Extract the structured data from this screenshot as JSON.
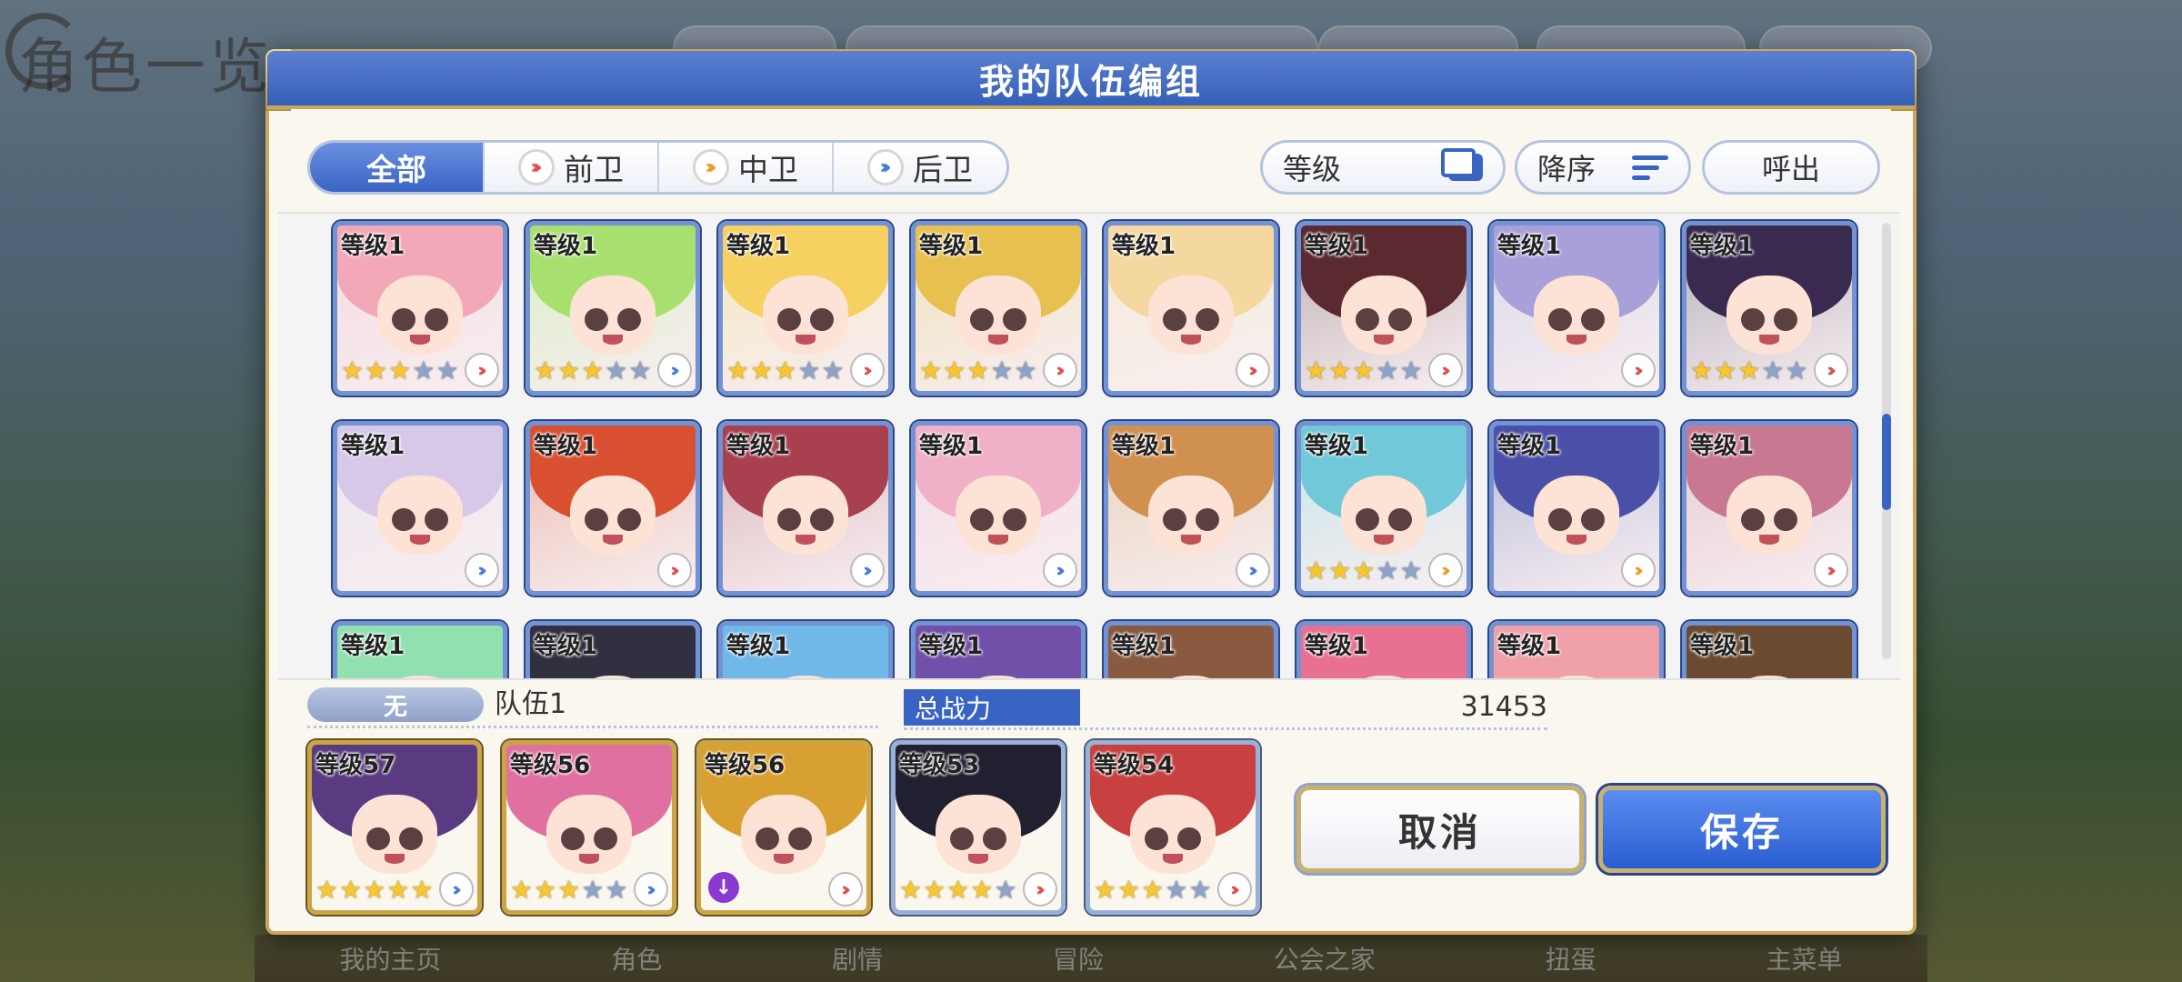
{
  "background": {
    "title": "角色一览",
    "nav": [
      "我的主页",
      "角色",
      "剧情",
      "冒险",
      "公会之家",
      "扭蛋",
      "主菜单"
    ]
  },
  "modal": {
    "title": "我的队伍编组",
    "tabs": [
      {
        "label": "全部",
        "icon": ""
      },
      {
        "label": "前卫",
        "icon": "front-role-icon"
      },
      {
        "label": "中卫",
        "icon": "mid-role-icon"
      },
      {
        "label": "后卫",
        "icon": "back-role-icon"
      }
    ],
    "sort_level_label": "等级",
    "sort_order_label": "降序",
    "call_label": "呼出",
    "level_text": "等级1",
    "grid_rows": [
      [
        {
          "stars": 3,
          "max": 5,
          "role": "front",
          "hair": "#f3a8b8"
        },
        {
          "stars": 3,
          "max": 5,
          "role": "back",
          "hair": "#a8e070"
        },
        {
          "stars": 3,
          "max": 5,
          "role": "front",
          "hair": "#f6d060"
        },
        {
          "stars": 3,
          "max": 5,
          "role": "front",
          "hair": "#e8c050"
        },
        {
          "stars": 0,
          "max": 0,
          "role": "front",
          "hair": "#f4d8a0"
        },
        {
          "stars": 3,
          "max": 5,
          "role": "front",
          "hair": "#5a2a30"
        },
        {
          "stars": 0,
          "max": 0,
          "role": "front",
          "hair": "#a8a0d8"
        },
        {
          "stars": 3,
          "max": 5,
          "role": "front",
          "hair": "#3a2a50"
        }
      ],
      [
        {
          "stars": 0,
          "max": 0,
          "role": "back",
          "hair": "#d8c8e8"
        },
        {
          "stars": 0,
          "max": 0,
          "role": "front",
          "hair": "#d85030"
        },
        {
          "stars": 0,
          "max": 0,
          "role": "back",
          "hair": "#a84050"
        },
        {
          "stars": 0,
          "max": 0,
          "role": "back",
          "hair": "#f0b0c8"
        },
        {
          "stars": 0,
          "max": 0,
          "role": "back",
          "hair": "#d09050"
        },
        {
          "stars": 3,
          "max": 5,
          "role": "mid",
          "hair": "#70c8d8"
        },
        {
          "stars": 0,
          "max": 0,
          "role": "mid",
          "hair": "#4a50a8"
        },
        {
          "stars": 0,
          "max": 0,
          "role": "front",
          "hair": "#c87890"
        }
      ],
      [
        {
          "stars": 0,
          "max": 0,
          "role": "",
          "hair": "#90e0b0"
        },
        {
          "stars": 0,
          "max": 0,
          "role": "",
          "hair": "#303040"
        },
        {
          "stars": 0,
          "max": 0,
          "role": "",
          "hair": "#70b8e8"
        },
        {
          "stars": 0,
          "max": 0,
          "role": "",
          "hair": "#7050a8"
        },
        {
          "stars": 0,
          "max": 0,
          "role": "",
          "hair": "#8a5a40"
        },
        {
          "stars": 0,
          "max": 0,
          "role": "",
          "hair": "#e87090"
        },
        {
          "stars": 0,
          "max": 0,
          "role": "",
          "hair": "#f0a0a8"
        },
        {
          "stars": 0,
          "max": 0,
          "role": "",
          "hair": "#6a4a30"
        }
      ]
    ],
    "team": {
      "badge": "无",
      "name": "队伍1",
      "power_label": "总战力",
      "power_value": "31453",
      "members": [
        {
          "level": "等级57",
          "stars": 5,
          "max": 5,
          "role": "back",
          "frame": "gold",
          "hair": "#5a3a80"
        },
        {
          "level": "等级56",
          "stars": 3,
          "max": 5,
          "role": "back",
          "frame": "gold",
          "hair": "#e070a0"
        },
        {
          "level": "等级56",
          "stars": 0,
          "max": 0,
          "role": "front",
          "frame": "gold",
          "hair": "#d8a030",
          "special": true
        },
        {
          "level": "等级53",
          "stars": 4,
          "max": 5,
          "role": "front",
          "frame": "silver",
          "hair": "#202030"
        },
        {
          "level": "等级54",
          "stars": 3,
          "max": 5,
          "role": "front",
          "frame": "silver",
          "hair": "#c84040"
        }
      ]
    },
    "cancel_label": "取消",
    "save_label": "保存"
  }
}
